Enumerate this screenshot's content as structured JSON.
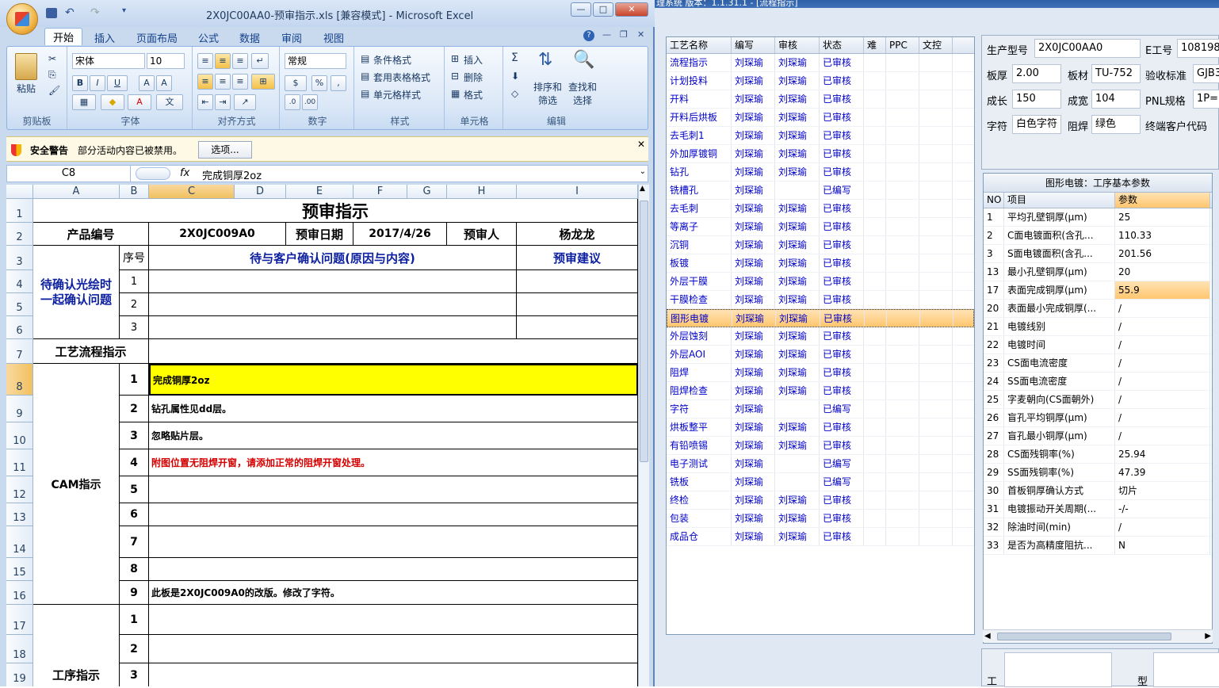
{
  "bg_title": "理系统   版本：1.1.31.1 - [流程指示]",
  "process_table": {
    "headers": [
      "工艺名称",
      "编写",
      "审核",
      "状态",
      "难",
      "PPC",
      "文控"
    ],
    "rows": [
      [
        "流程指示",
        "刘琛瑜",
        "刘琛瑜",
        "已审核"
      ],
      [
        "计划投料",
        "刘琛瑜",
        "刘琛瑜",
        "已审核"
      ],
      [
        "开料",
        "刘琛瑜",
        "刘琛瑜",
        "已审核"
      ],
      [
        "开料后烘板",
        "刘琛瑜",
        "刘琛瑜",
        "已审核"
      ],
      [
        "去毛刺1",
        "刘琛瑜",
        "刘琛瑜",
        "已审核"
      ],
      [
        "外加厚镀铜",
        "刘琛瑜",
        "刘琛瑜",
        "已审核"
      ],
      [
        "钻孔",
        "刘琛瑜",
        "刘琛瑜",
        "已审核"
      ],
      [
        "铣槽孔",
        "刘琛瑜",
        "",
        "已编写"
      ],
      [
        "去毛刺",
        "刘琛瑜",
        "刘琛瑜",
        "已审核"
      ],
      [
        "等离子",
        "刘琛瑜",
        "刘琛瑜",
        "已审核"
      ],
      [
        "沉铜",
        "刘琛瑜",
        "刘琛瑜",
        "已审核"
      ],
      [
        "板镀",
        "刘琛瑜",
        "刘琛瑜",
        "已审核"
      ],
      [
        "外层干膜",
        "刘琛瑜",
        "刘琛瑜",
        "已审核"
      ],
      [
        "干膜检查",
        "刘琛瑜",
        "刘琛瑜",
        "已审核"
      ],
      [
        "图形电镀",
        "刘琛瑜",
        "刘琛瑜",
        "已审核"
      ],
      [
        "外层蚀刻",
        "刘琛瑜",
        "刘琛瑜",
        "已审核"
      ],
      [
        "外层AOI",
        "刘琛瑜",
        "刘琛瑜",
        "已审核"
      ],
      [
        "阻焊",
        "刘琛瑜",
        "刘琛瑜",
        "已审核"
      ],
      [
        "阻焊检查",
        "刘琛瑜",
        "刘琛瑜",
        "已审核"
      ],
      [
        "字符",
        "刘琛瑜",
        "",
        "已编写"
      ],
      [
        "烘板整平",
        "刘琛瑜",
        "刘琛瑜",
        "已审核"
      ],
      [
        "有铅喷锡",
        "刘琛瑜",
        "刘琛瑜",
        "已审核"
      ],
      [
        "电子测试",
        "刘琛瑜",
        "",
        "已编写"
      ],
      [
        "铣板",
        "刘琛瑜",
        "",
        "已编写"
      ],
      [
        "终检",
        "刘琛瑜",
        "刘琛瑜",
        "已审核"
      ],
      [
        "包装",
        "刘琛瑜",
        "刘琛瑜",
        "已审核"
      ],
      [
        "成品仓",
        "刘琛瑜",
        "刘琛瑜",
        "已审核"
      ]
    ],
    "selected_index": 14
  },
  "info": {
    "l1": "生产型号",
    "v1": "2X0JC00AA0",
    "l2": "E工号",
    "v2": "108198",
    "l3": "板厚",
    "v3": "2.00",
    "l4": "板材",
    "v4": "TU-752",
    "l5": "验收标准",
    "v5": "GJB3",
    "l6": "成长",
    "v6": "150",
    "l7": "成宽",
    "v7": "104",
    "l8": "PNL规格",
    "v8": "1P=1",
    "l9": "字符",
    "v9": "白色字符",
    "l10": "阻焊",
    "v10": "绿色",
    "l11": "终端客户代码"
  },
  "params": {
    "title": "图形电镀：工序基本参数",
    "headers": [
      "NO",
      "项目",
      "参数"
    ],
    "rows": [
      [
        "1",
        "平均孔壁铜厚(μm)",
        "25"
      ],
      [
        "2",
        "C面电镀面积(含孔...",
        "110.33"
      ],
      [
        "3",
        "S面电镀面积(含孔...",
        "201.56"
      ],
      [
        "13",
        "最小孔壁铜厚(μm)",
        "20"
      ],
      [
        "17",
        "表面完成铜厚(μm)",
        "55.9"
      ],
      [
        "20",
        "表面最小完成铜厚(...",
        "/"
      ],
      [
        "21",
        "电镀线别",
        "/"
      ],
      [
        "22",
        "电镀时间",
        "/"
      ],
      [
        "23",
        "CS面电流密度",
        "/"
      ],
      [
        "24",
        "SS面电流密度",
        "/"
      ],
      [
        "25",
        "字麦朝向(CS面朝外)",
        "/"
      ],
      [
        "26",
        "盲孔平均铜厚(μm)",
        "/"
      ],
      [
        "27",
        "盲孔最小铜厚(μm)",
        "/"
      ],
      [
        "28",
        "CS面残铜率(%)",
        "25.94"
      ],
      [
        "29",
        "SS面残铜率(%)",
        "47.39"
      ],
      [
        "30",
        "首板铜厚确认方式",
        "切片"
      ],
      [
        "31",
        "电镀振动开关周期(...",
        "-/-"
      ],
      [
        "32",
        "除油时间(min)",
        "/"
      ],
      [
        "33",
        "是否为高精度阻抗...",
        "N"
      ]
    ],
    "highlight_index": 4,
    "bottom_l1": "工",
    "bottom_l2": "型"
  },
  "excel": {
    "title": "2X0JC00AA0-预审指示.xls  [兼容模式] - Microsoft Excel",
    "tabs": [
      "开始",
      "插入",
      "页面布局",
      "公式",
      "数据",
      "审阅",
      "视图"
    ],
    "font_name": "宋体",
    "font_size": "10",
    "number_format": "常规",
    "groups": [
      "剪贴板",
      "字体",
      "对齐方式",
      "数字",
      "样式",
      "单元格",
      "编辑"
    ],
    "paste": "粘贴",
    "style_items": [
      "条件格式",
      "套用表格格式",
      "单元格样式"
    ],
    "cell_items": [
      "插入",
      "删除",
      "格式"
    ],
    "sort": "排序和\n筛选",
    "find": "查找和\n选择",
    "sum": "Σ",
    "security_title": "安全警告",
    "security_msg": "部分活动内容已被禁用。",
    "security_btn": "选项...",
    "name_box": "C8",
    "fx": "fx",
    "formula": "完成铜厚2oz"
  },
  "sheet": {
    "cols": [
      "A",
      "B",
      "C",
      "D",
      "E",
      "F",
      "G",
      "H",
      "I"
    ],
    "rows": [
      "1",
      "2",
      "3",
      "4",
      "5",
      "6",
      "7",
      "8",
      "9",
      "10",
      "11",
      "12",
      "13",
      "14",
      "15",
      "16",
      "17",
      "18",
      "19"
    ],
    "title": "预审指示",
    "product_no_label": "产品编号",
    "product_no": "2X0JC009A0",
    "date_label": "预审日期",
    "date": "2017/4/26",
    "reviewer_label": "预审人",
    "reviewer": "杨龙龙",
    "seq_label": "序号",
    "issue_label": "待与客户确认问题(原因与内容)",
    "suggest_label": "预审建议",
    "pending_label": "待确认光绘时\n一起确认问题",
    "flow_label": "工艺流程指示",
    "cam_label": "CAM指示",
    "proc_label": "工序指示",
    "n1": "1",
    "n2": "2",
    "n3": "3",
    "n4": "4",
    "n5": "5",
    "n6": "6",
    "n7": "7",
    "n8": "8",
    "n9": "9",
    "cam1": "完成铜厚2oz",
    "cam2": "钻孔属性见dd层。",
    "cam3": "忽略贴片层。",
    "cam4": "附图位置无阻焊开窗，请添加正常的阻焊开窗处理。",
    "cam9": "此板是2X0JC009A0的改版。修改了字符。"
  }
}
